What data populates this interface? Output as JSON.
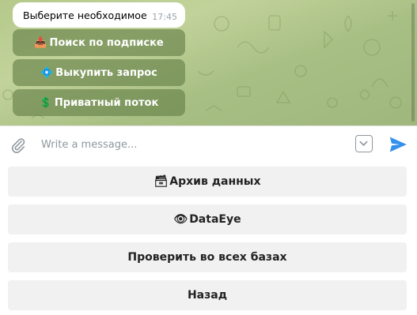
{
  "chat": {
    "message": {
      "text": "Выберите необходимое",
      "time": "17:45"
    },
    "inline_buttons": [
      {
        "icon": "inbox-tray-icon",
        "glyph": "📥",
        "label": "Поиск по подписке"
      },
      {
        "icon": "diamond-icon",
        "glyph": "💠",
        "label": "Выкупить запрос"
      },
      {
        "icon": "dollar-icon",
        "glyph": "💲",
        "label": "Приватный поток"
      }
    ]
  },
  "composer": {
    "placeholder": "Write a message..."
  },
  "keyboard": {
    "buttons": [
      {
        "icon": "archive-box-icon",
        "glyph": "🗃",
        "label": "Архив данных"
      },
      {
        "icon": "eye-icon",
        "glyph": "👁",
        "label": "DataEye"
      },
      {
        "icon": "",
        "glyph": "",
        "label": "Проверить во всех базах"
      },
      {
        "icon": "",
        "glyph": "",
        "label": "Назад"
      }
    ]
  },
  "colors": {
    "accent": "#3390ec",
    "chat_bg": "#b5c98c",
    "inline_button_bg": "#627e45",
    "keyboard_button_bg": "#f1f1f1"
  }
}
